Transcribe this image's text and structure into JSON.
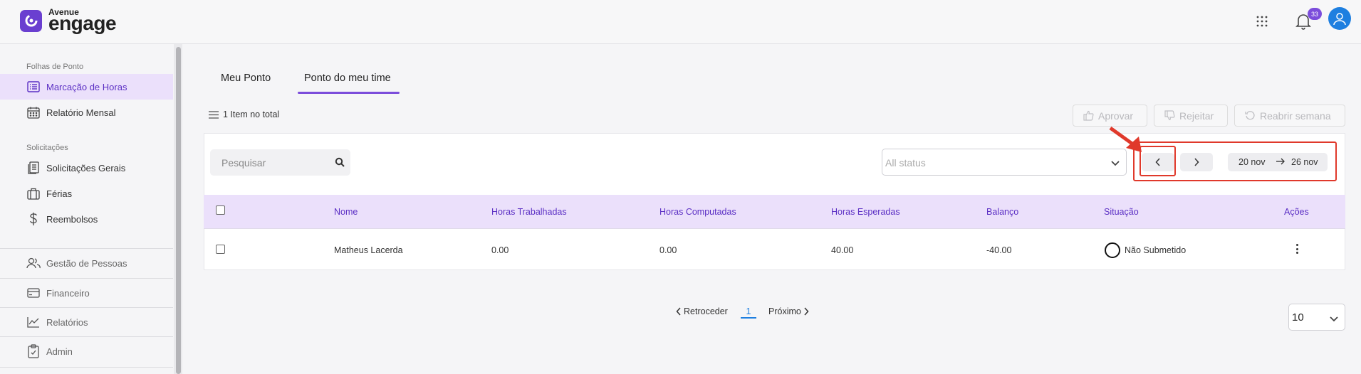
{
  "header": {
    "brand_top": "Avenue",
    "brand_main": "engage",
    "notification_count": "33"
  },
  "sidebar": {
    "section_timesheets": "Folhas de Ponto",
    "timesheet_items": [
      {
        "label": "Marcação de Horas",
        "icon": "list-clock-icon",
        "active": true
      },
      {
        "label": "Relatório Mensal",
        "icon": "calendar-icon",
        "active": false
      }
    ],
    "section_requests": "Solicitações",
    "request_items": [
      {
        "label": "Solicitações Gerais",
        "icon": "document-list-icon"
      },
      {
        "label": "Férias",
        "icon": "suitcase-icon"
      },
      {
        "label": "Reembolsos",
        "icon": "dollar-icon"
      }
    ],
    "other_items": [
      {
        "label": "Gestão de Pessoas",
        "icon": "people-icon"
      },
      {
        "label": "Financeiro",
        "icon": "credit-card-icon"
      },
      {
        "label": "Relatórios",
        "icon": "chart-line-icon"
      },
      {
        "label": "Admin",
        "icon": "clipboard-icon"
      }
    ]
  },
  "tabs": [
    {
      "label": "Meu Ponto",
      "active": false
    },
    {
      "label": "Ponto do meu time",
      "active": true
    }
  ],
  "total_label": "1 Item no total",
  "actions": {
    "approve": "Aprovar",
    "reject": "Rejeitar",
    "reopen": "Reabrir semana"
  },
  "filters": {
    "search_placeholder": "Pesquisar",
    "status_placeholder": "All status",
    "date_start": "20 nov",
    "date_end": "26 nov"
  },
  "table": {
    "columns": [
      "Nome",
      "Horas Trabalhadas",
      "Horas Computadas",
      "Horas Esperadas",
      "Balanço",
      "Situação",
      "Ações"
    ],
    "rows": [
      {
        "nome": "Matheus Lacerda",
        "horas_trabalhadas": "0.00",
        "horas_computadas": "0.00",
        "horas_esperadas": "40.00",
        "balanco": "-40.00",
        "situacao": "Não Submetido"
      }
    ]
  },
  "pagination": {
    "prev": "Retroceder",
    "current": "1",
    "next": "Próximo",
    "per_page": "10"
  },
  "colors": {
    "accent": "#7c4ddb",
    "active_bg": "#ebe0fb",
    "annotation_red": "#e0392b"
  }
}
